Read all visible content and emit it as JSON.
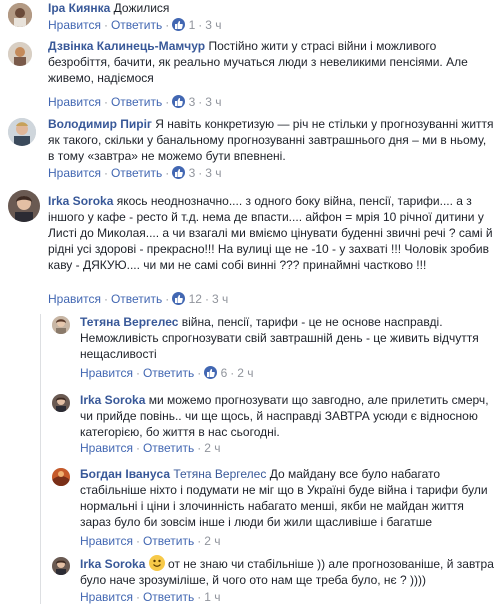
{
  "actions": {
    "like": "Нравится",
    "reply": "Ответить",
    "sep": "·"
  },
  "comments": [
    {
      "author": "Іра Киянка",
      "text": "Дожилися",
      "likes": "1",
      "time": "3 ч"
    },
    {
      "author": "Дзвінка Калинець-Мамчур",
      "text": "Постійно жити у страсі війни і можливого безробіття, бачити, як реально мучаться люди з невеликими пенсіями. Але живемо, надіємося",
      "likes": "3",
      "time": "3 ч"
    },
    {
      "author": "Володимир Пиріг",
      "text": "Я навіть конкретизую — річ не стільки у прогнозуванні життя як такого, скільки у банальному прогнозуванні завтрашнього дня – ми в ньому, в тому «завтра» не можемо бути впевнені.",
      "likes": "3",
      "time": "3 ч"
    },
    {
      "author": "Irka Soroka",
      "text": "якось неоднозначно.... з одного боку війна, пенсії, тарифи.... а з іншого у кафе - ресто й т.д. нема де впасти.... айфон = мрія 10 річної дитини у Листі до Миколая.... а чи взагалі ми вміємо цінувати буденні звичні речі ? самі й рідні усі здорові - прекрасно!!! На вулиці ще не -10 - у захваті !!! Чоловік зробив каву - ДЯКУЮ.... чи ми не самі собі винні ??? принаймні частково !!!",
      "likes": "12",
      "time": "3 ч"
    },
    {
      "author": "Тетяна Вергелес",
      "text": "війна, пенсії, тарифи - це не основе насправді. Неможливість спрогнозувати свій завтрашній день - це живить відчуття нещасливості",
      "likes": "6",
      "time": "2 ч"
    },
    {
      "author": "Irka Soroka",
      "text": "ми можемо прогнозувати що завгодно, але прилетить смерч, чи прийде повінь.. чи ще щось, й насправді ЗАВТРА усюди є відносною категорією, бо життя в нас сьогодні.",
      "likes": "",
      "time": "2 ч"
    },
    {
      "author": "Богдан Іванyса",
      "reply_to": "Тетяна Вергелес",
      "text": "До майдану все було набагато стабільніше ніхто і подумати не міг що в Україні буде війна і тарифи були нормальні і ціни і злочинність набагато менші, якби не майдан життя зараз було би зовсім інше і люди би жили щасливіше і багатше",
      "likes": "",
      "time": "2 ч"
    },
    {
      "author": "Irka Soroka",
      "text": " от не знаю чи стабільніше )) але прогнозованіше, й завтра було наче зрозуміліше, й чого ото нам ще треба було, нє ? ))))",
      "likes": "",
      "time": "1 ч"
    }
  ],
  "colors": {
    "link": "#385898",
    "action": "#4267b2",
    "meta": "#90949c",
    "like_badge": "#4267b2"
  }
}
